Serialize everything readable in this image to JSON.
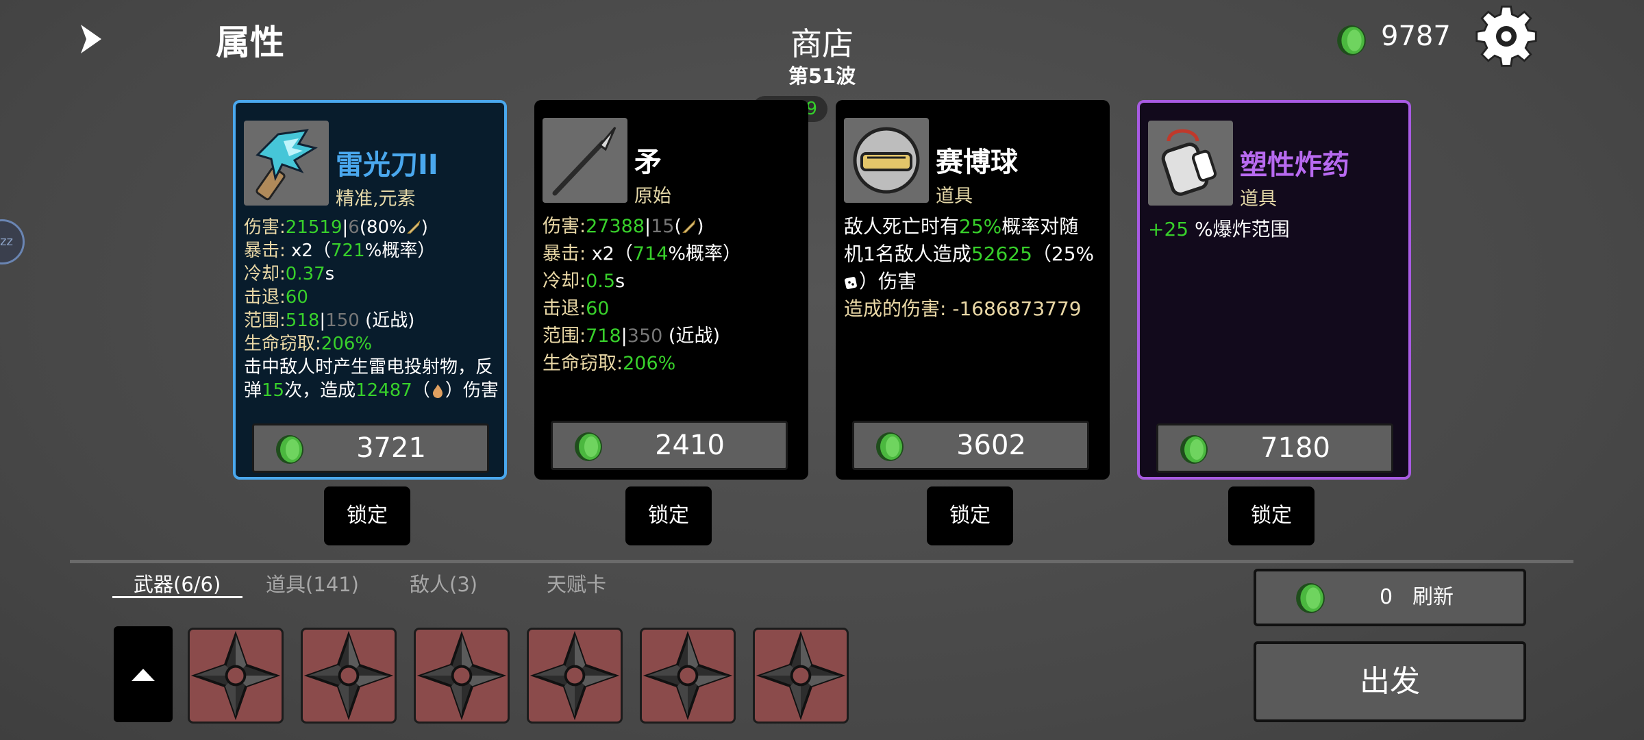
{
  "header": {
    "attributes_title": "属性",
    "shop_title": "商店",
    "wave": "第51波",
    "gold": "9787",
    "fps": "FPS59",
    "side_badge": "zz"
  },
  "colors": {
    "stat_value_green": "#38d02b",
    "stat_key": "#ead8a6",
    "selected_border": "#4aa8ee",
    "rare_border": "#a85be3",
    "item_name_blue": "#4aa8ee",
    "item_name_purple": "#b86af0",
    "slot_bg": "#8b4b4b"
  },
  "cards": [
    {
      "name": "雷光刀II",
      "tag": "精准,元素",
      "icon": "lightning-blade-icon",
      "stats": {
        "damage_label": "伤害",
        "damage": "21519",
        "damage_base": "6",
        "damage_pct": "(80%",
        "damage_close": ")",
        "crit_label": "暴击",
        "crit_mult": "x2（",
        "crit_pct": "721",
        "crit_suffix": "%概率）",
        "cooldown_label": "冷却",
        "cooldown": "0.37",
        "cooldown_unit": "s",
        "knockback_label": "击退",
        "knockback": "60",
        "range_label": "范围",
        "range": "518",
        "range_base": "150",
        "range_type": "(近战)",
        "lifesteal_label": "生命窃取",
        "lifesteal": "206%",
        "effect_a": "击中敌人时产生雷电投射物，反",
        "effect_b1": "弹",
        "effect_bounce": "15",
        "effect_b2": "次，造成",
        "effect_dmg": "12487",
        "effect_b3": "（",
        "effect_b4": "）伤害"
      },
      "price": "3721",
      "lock_label": "锁定"
    },
    {
      "name": "矛",
      "tag": "原始",
      "icon": "spear-icon",
      "stats": {
        "damage_label": "伤害",
        "damage": "27388",
        "damage_base": "15",
        "damage_open": "(",
        "damage_close": ")",
        "crit_label": "暴击",
        "crit_mult": "x2（",
        "crit_pct": "714",
        "crit_suffix": "%概率）",
        "cooldown_label": "冷却",
        "cooldown": "0.5",
        "cooldown_unit": "s",
        "knockback_label": "击退",
        "knockback": "60",
        "range_label": "范围",
        "range": "718",
        "range_base": "350",
        "range_type": "(近战)",
        "lifesteal_label": "生命窃取",
        "lifesteal": "206%"
      },
      "price": "2410",
      "lock_label": "锁定"
    },
    {
      "name": "赛博球",
      "tag": "道具",
      "icon": "cyber-ball-icon",
      "desc": {
        "l1a": "敌人死亡时有",
        "l1pct": "25%",
        "l1b": "概率对随",
        "l2a": "机1名敌人造成",
        "l2dmg": "52625",
        "l2b": "（25%",
        "l3": "）伤害",
        "dealt_label": "造成的伤害:",
        "dealt_value": "-1686873779"
      },
      "price": "3602",
      "lock_label": "锁定"
    },
    {
      "name": "塑性炸药",
      "tag": "道具",
      "icon": "plastic-explosive-icon",
      "desc": {
        "bonus": "+25",
        "text": "%爆炸范围"
      },
      "price": "7180",
      "lock_label": "锁定"
    }
  ],
  "tabs": [
    {
      "label": "武器(6/6)",
      "active": true
    },
    {
      "label": "道具(141)",
      "active": false
    },
    {
      "label": "敌人(3)",
      "active": false
    },
    {
      "label": "天赋卡",
      "active": false
    }
  ],
  "weapon_slots": [
    {
      "icon": "shuriken-icon"
    },
    {
      "icon": "shuriken-icon"
    },
    {
      "icon": "shuriken-icon"
    },
    {
      "icon": "shuriken-icon"
    },
    {
      "icon": "shuriken-icon"
    },
    {
      "icon": "shuriken-icon"
    }
  ],
  "refresh": {
    "cost": "0",
    "label": "刷新"
  },
  "go_label": "出发"
}
